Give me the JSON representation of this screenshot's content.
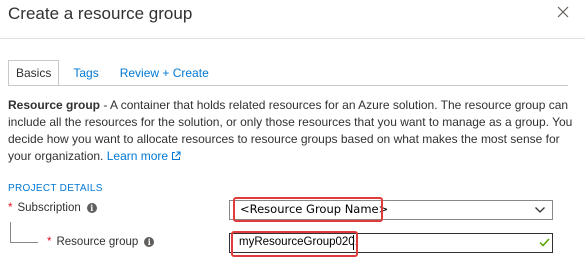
{
  "window": {
    "title": "Create a resource group"
  },
  "tabs": [
    {
      "label": "Basics"
    },
    {
      "label": "Tags"
    },
    {
      "label": "Review + Create"
    }
  ],
  "description": {
    "term": "Resource group",
    "text": " - A container that holds related resources for an Azure solution. The resource group can include all the resources for the solution, or only those resources that you want to manage as a group. You decide how you want to allocate resources to resource groups based on what makes the most sense for your organization. ",
    "learn_more": "Learn more"
  },
  "section_title": "PROJECT DETAILS",
  "fields": {
    "subscription": {
      "required_mark": "*",
      "label": "Subscription",
      "value": "<Resource Group Name>"
    },
    "resource_group": {
      "required_mark": "*",
      "label": "Resource group",
      "value": "myResourceGroup0201"
    }
  },
  "colors": {
    "accent": "#0078d4",
    "required": "#e81123",
    "highlight": "#e03c3c",
    "valid": "#57a300"
  },
  "icons": [
    "close-icon",
    "external-link-icon",
    "info-icon",
    "chevron-down-icon",
    "checkmark-icon"
  ]
}
